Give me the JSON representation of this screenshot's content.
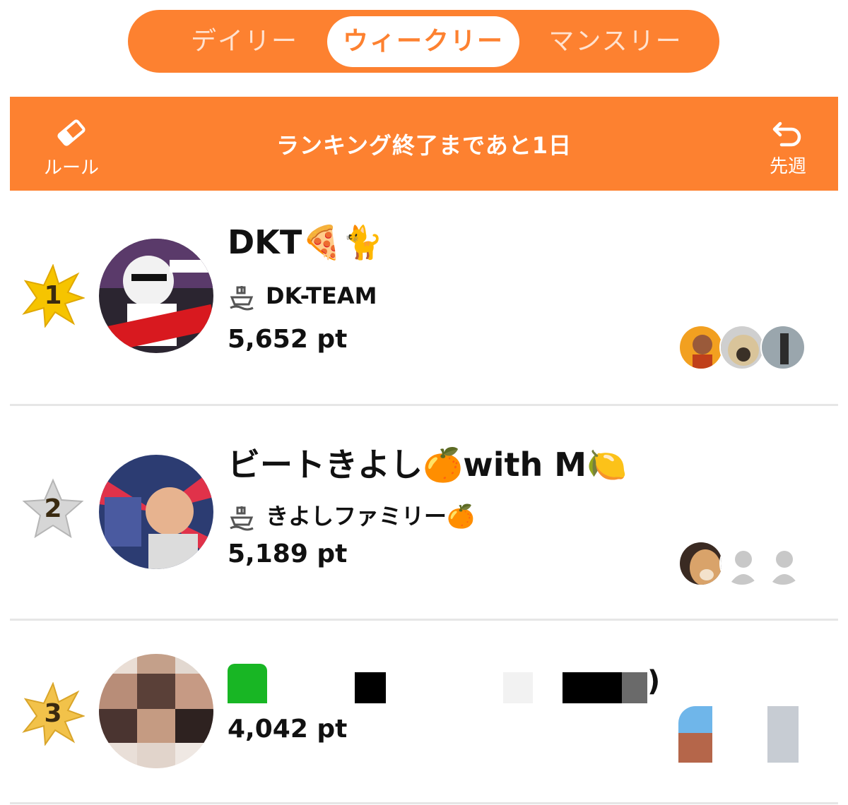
{
  "tabs": [
    {
      "label": "デイリー",
      "active": false
    },
    {
      "label": "ウィークリー",
      "active": true
    },
    {
      "label": "マンスリー",
      "active": false
    }
  ],
  "header": {
    "rules_label": "ルール",
    "title": "ランキング終了まであと1日",
    "prev_week_label": "先週",
    "rules_icon": "eraser-icon",
    "prev_icon": "undo-arrow-icon"
  },
  "colors": {
    "accent": "#fd8130",
    "divider": "#e6e6e6"
  },
  "rankings": [
    {
      "rank": "1",
      "name": "DKT🍕🐈",
      "team": "DK-TEAM",
      "points": "5,652 pt",
      "badge_color": "#f6c400",
      "supporters": [
        "supporter-avatar-1",
        "supporter-avatar-2",
        "supporter-avatar-3"
      ]
    },
    {
      "rank": "2",
      "name": "ビートきよし🍊with M🍋",
      "team": "きよしファミリー🍊",
      "points": "5,189 pt",
      "badge_color": "#cfcfcf",
      "supporters": [
        "supporter-avatar-1",
        "supporter-avatar-placeholder",
        "supporter-avatar-placeholder"
      ]
    },
    {
      "rank": "3",
      "name": ")",
      "points": "4,042 pt",
      "badge_color": "#f2c24a",
      "supporters": [
        "supporter-avatar-1",
        "supporter-avatar-placeholder"
      ]
    }
  ]
}
